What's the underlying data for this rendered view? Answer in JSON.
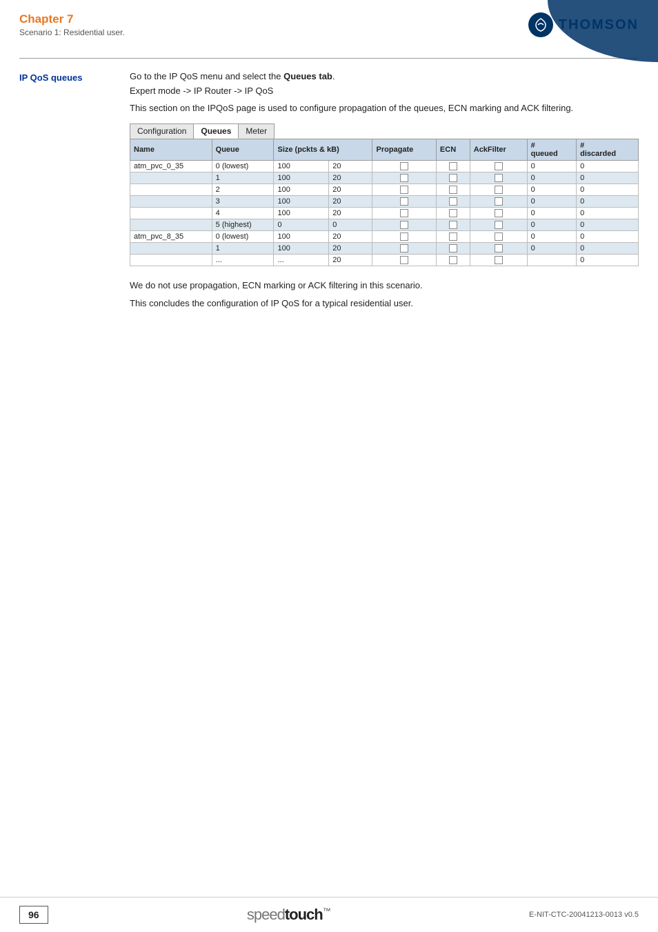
{
  "header": {
    "chapter": "Chapter 7",
    "subtitle": "Scenario 1: Residential user.",
    "thomson_label": "THOMSON"
  },
  "section": {
    "label": "IP QoS queues",
    "intro": "Go to the IP QoS menu and select the ",
    "intro_bold": "Queues tab",
    "intro_end": ".",
    "breadcrumb": "Expert mode ->  IP Router ->  IP QoS",
    "description": "This section on the IPQoS page is used to configure propagation of the queues, ECN marking and ACK filtering."
  },
  "tabs": [
    {
      "label": "Configuration",
      "active": false
    },
    {
      "label": "Queues",
      "active": true
    },
    {
      "label": "Meter",
      "active": false
    }
  ],
  "table": {
    "headers": [
      "Name",
      "Queue",
      "Size (pckts & kB)",
      "",
      "Propagate",
      "ECN",
      "AckFilter",
      "# queued",
      "# discarded"
    ],
    "rows": [
      {
        "name": "atm_pvc_0_35",
        "queue": "0 (lowest)",
        "pkts": "100",
        "kb": "20",
        "propagate": false,
        "ecn": false,
        "ackfilter": false,
        "queued": "0",
        "discarded": "0",
        "stripe": "odd"
      },
      {
        "name": "",
        "queue": "1",
        "pkts": "100",
        "kb": "20",
        "propagate": false,
        "ecn": false,
        "ackfilter": false,
        "queued": "0",
        "discarded": "0",
        "stripe": "even"
      },
      {
        "name": "",
        "queue": "2",
        "pkts": "100",
        "kb": "20",
        "propagate": false,
        "ecn": false,
        "ackfilter": false,
        "queued": "0",
        "discarded": "0",
        "stripe": "odd"
      },
      {
        "name": "",
        "queue": "3",
        "pkts": "100",
        "kb": "20",
        "propagate": false,
        "ecn": false,
        "ackfilter": false,
        "queued": "0",
        "discarded": "0",
        "stripe": "even"
      },
      {
        "name": "",
        "queue": "4",
        "pkts": "100",
        "kb": "20",
        "propagate": false,
        "ecn": false,
        "ackfilter": false,
        "queued": "0",
        "discarded": "0",
        "stripe": "odd"
      },
      {
        "name": "",
        "queue": "5 (highest)",
        "pkts": "0",
        "kb": "0",
        "propagate": false,
        "ecn": false,
        "ackfilter": false,
        "queued": "0",
        "discarded": "0",
        "stripe": "even"
      },
      {
        "name": "atm_pvc_8_35",
        "queue": "0 (lowest)",
        "pkts": "100",
        "kb": "20",
        "propagate": false,
        "ecn": false,
        "ackfilter": false,
        "queued": "0",
        "discarded": "0",
        "stripe": "odd"
      },
      {
        "name": "",
        "queue": "1",
        "pkts": "100",
        "kb": "20",
        "propagate": false,
        "ecn": false,
        "ackfilter": false,
        "queued": "0",
        "discarded": "0",
        "stripe": "even"
      },
      {
        "name": "",
        "queue": "...",
        "pkts": "...",
        "kb": "20",
        "propagate": false,
        "ecn": false,
        "ackfilter": false,
        "queued": "",
        "discarded": "0",
        "stripe": "odd"
      }
    ]
  },
  "footer": {
    "line1": "We do not use propagation, ECN marking or ACK filtering in this scenario.",
    "line2": "This concludes the configuration of IP QoS for a typical residential user."
  },
  "bottom": {
    "page_number": "96",
    "logo_light": "speed",
    "logo_bold": "touch",
    "logo_tm": "™",
    "doc_ref": "E-NIT-CTC-20041213-0013 v0.5"
  }
}
